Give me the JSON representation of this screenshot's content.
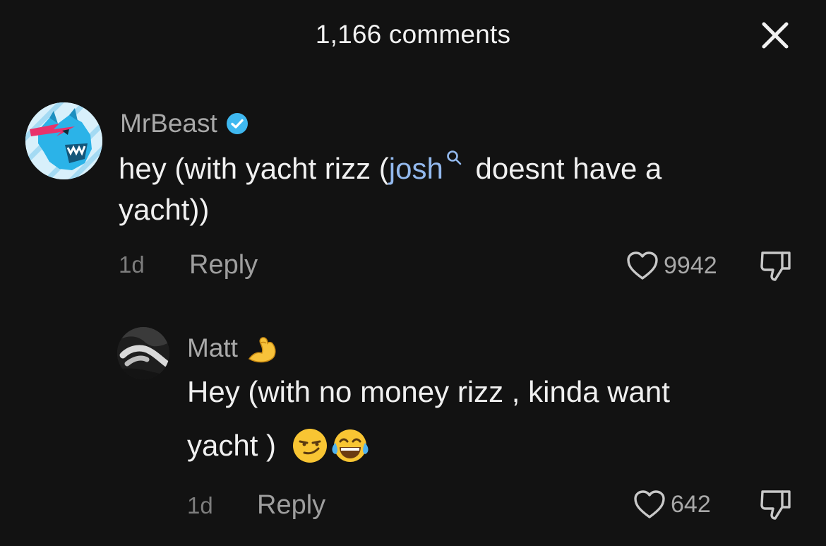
{
  "header": {
    "title": "1,166 comments",
    "close_icon": "close-icon"
  },
  "comments": [
    {
      "username": "MrBeast",
      "verified": true,
      "text_before": "hey (with yacht rizz (",
      "mention": "josh",
      "text_after": " doesnt have a",
      "text_line2": "yacht))",
      "time": "1d",
      "reply_label": "Reply",
      "likes": "9942"
    },
    {
      "username": "Matt",
      "username_emoji": "flexed-biceps-emoji",
      "text_line1": "Hey (with no money rizz , kinda want",
      "text_line2": "yacht ) ",
      "line2_emojis": [
        "smirking-face-emoji",
        "face-with-tears-of-joy-emoji"
      ],
      "time": "1d",
      "reply_label": "Reply",
      "likes": "642"
    }
  ],
  "colors": {
    "background": "#121212",
    "mention": "#93b9ee",
    "verified": "#3fb8f0"
  }
}
